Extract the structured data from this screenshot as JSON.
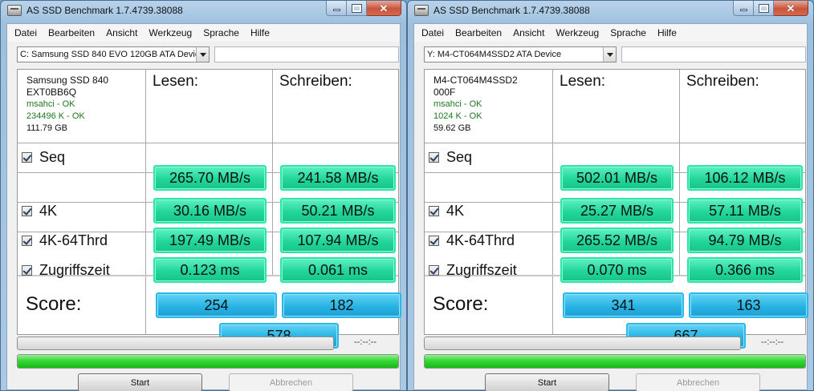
{
  "windows": [
    {
      "title": "AS SSD Benchmark 1.7.4739.38088",
      "menu": [
        "Datei",
        "Bearbeiten",
        "Ansicht",
        "Werkzeug",
        "Sprache",
        "Hilfe"
      ],
      "drive_select": "C: Samsung SSD 840 EVO 120GB ATA Devic",
      "info": {
        "model": "Samsung SSD 840",
        "firmware": "EXT0BB6Q",
        "driver": "msahci - OK",
        "alignment": "234496 K - OK",
        "size": "111.79 GB"
      },
      "headers": {
        "read": "Lesen:",
        "write": "Schreiben:"
      },
      "rows": [
        {
          "label": "Seq",
          "read": "265.70 MB/s",
          "write": "241.58 MB/s"
        },
        {
          "label": "4K",
          "read": "30.16 MB/s",
          "write": "50.21 MB/s"
        },
        {
          "label": "4K-64Thrd",
          "read": "197.49 MB/s",
          "write": "107.94 MB/s"
        },
        {
          "label": "Zugriffszeit",
          "read": "0.123 ms",
          "write": "0.061 ms"
        }
      ],
      "score": {
        "label": "Score:",
        "read": "254",
        "write": "182",
        "total": "578"
      },
      "eta": "--:--:--",
      "progress_main": 1.0,
      "buttons": {
        "start": "Start",
        "cancel": "Abbrechen"
      }
    },
    {
      "title": "AS SSD Benchmark 1.7.4739.38088",
      "menu": [
        "Datei",
        "Bearbeiten",
        "Ansicht",
        "Werkzeug",
        "Sprache",
        "Hilfe"
      ],
      "drive_select": "Y: M4-CT064M4SSD2 ATA Device",
      "info": {
        "model": "M4-CT064M4SSD2",
        "firmware": "000F",
        "driver": "msahci - OK",
        "alignment": "1024 K - OK",
        "size": "59.62 GB"
      },
      "headers": {
        "read": "Lesen:",
        "write": "Schreiben:"
      },
      "rows": [
        {
          "label": "Seq",
          "read": "502.01 MB/s",
          "write": "106.12 MB/s"
        },
        {
          "label": "4K",
          "read": "25.27 MB/s",
          "write": "57.11 MB/s"
        },
        {
          "label": "4K-64Thrd",
          "read": "265.52 MB/s",
          "write": "94.79 MB/s"
        },
        {
          "label": "Zugriffszeit",
          "read": "0.070 ms",
          "write": "0.366 ms"
        }
      ],
      "score": {
        "label": "Score:",
        "read": "341",
        "write": "163",
        "total": "667"
      },
      "eta": "--:--:--",
      "progress_main": 1.0,
      "buttons": {
        "start": "Start",
        "cancel": "Abbrechen"
      }
    }
  ]
}
